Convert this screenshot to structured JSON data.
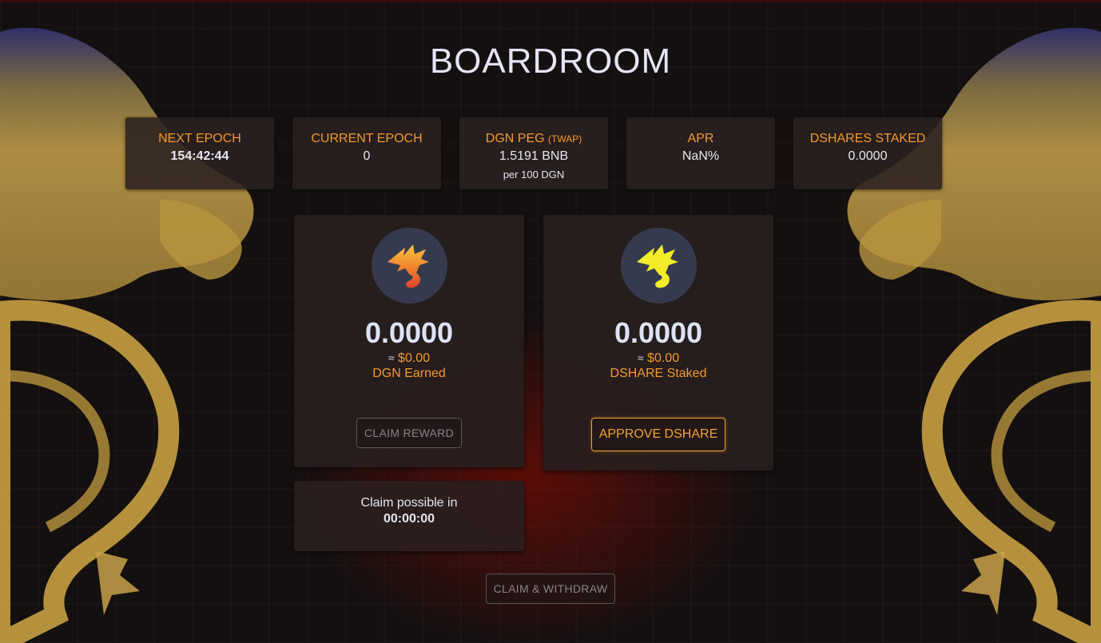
{
  "page": {
    "title": "BOARDROOM"
  },
  "stats": [
    {
      "label": "NEXT EPOCH",
      "value": "154:42:44"
    },
    {
      "label": "CURRENT EPOCH",
      "value": "0"
    },
    {
      "label": "DGN PEG",
      "label_small": "(TWAP)",
      "value": "1.5191 BNB",
      "sub": "per 100 DGN"
    },
    {
      "label": "APR",
      "value": "NaN%"
    },
    {
      "label": "DSHARES STAKED",
      "value": "0.0000"
    }
  ],
  "earned_card": {
    "icon": "orange-dragon-icon",
    "amount": "0.0000",
    "approx": "≈",
    "usd": "$0.00",
    "caption": "DGN Earned",
    "button": "CLAIM REWARD"
  },
  "staked_card": {
    "icon": "yellow-dragon-icon",
    "amount": "0.0000",
    "approx": "≈",
    "usd": "$0.00",
    "caption": "DSHARE Staked",
    "button": "APPROVE DSHARE"
  },
  "claim_timer": {
    "label": "Claim possible in",
    "value": "00:00:00"
  },
  "footer": {
    "button": "CLAIM & WITHDRAW"
  },
  "colors": {
    "accent": "#f29a2e",
    "background": "#141010",
    "card": "#2a2020",
    "coin_bg": "#363a4e"
  }
}
